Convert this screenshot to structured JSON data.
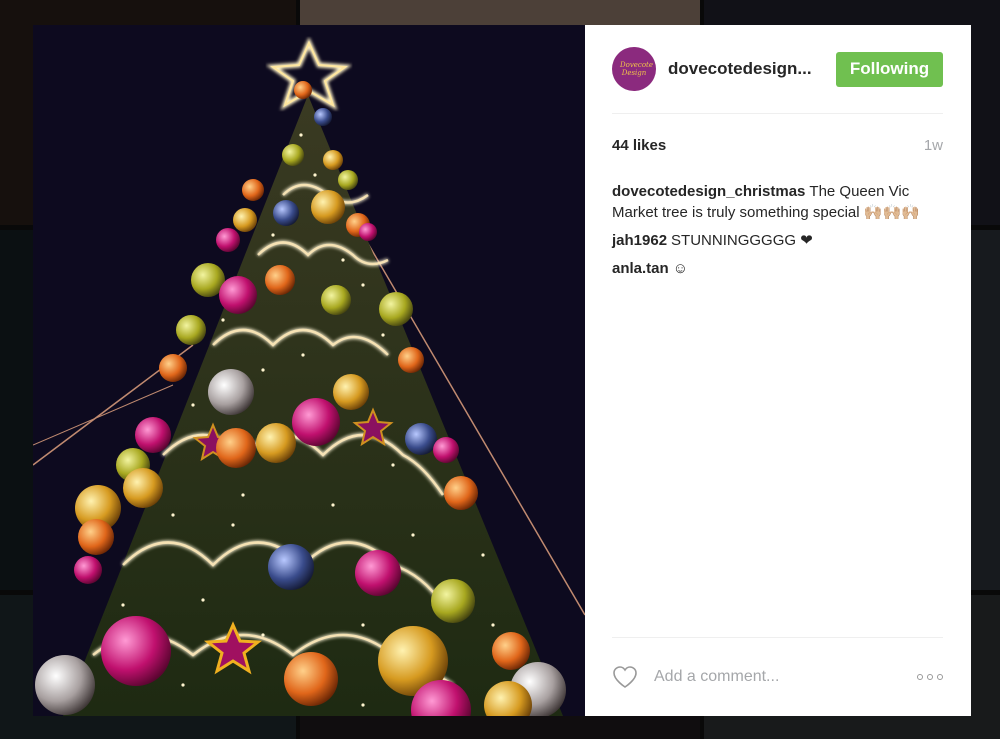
{
  "post": {
    "username": "dovecotedesign...",
    "follow_label": "Following",
    "likes": "44 likes",
    "age": "1w",
    "avatar_text": "Dovecote Design",
    "comments": [
      {
        "author": "dovecotedesign_christmas",
        "text": "The Queen Vic Market tree is truly something special 🙌🏼🙌🏼🙌🏼"
      },
      {
        "author": "jah1962",
        "text": "STUNNINGGGGG ❤"
      },
      {
        "author": "anla.tan",
        "text": "☺"
      }
    ],
    "comment_placeholder": "Add a comment..."
  },
  "colors": {
    "follow_button": "#70c050",
    "avatar": "#8b2a7e",
    "link_text": "#262626",
    "muted": "#a5a7aa"
  },
  "icons": {
    "like": "heart-outline-icon",
    "more": "ellipsis-icon"
  }
}
